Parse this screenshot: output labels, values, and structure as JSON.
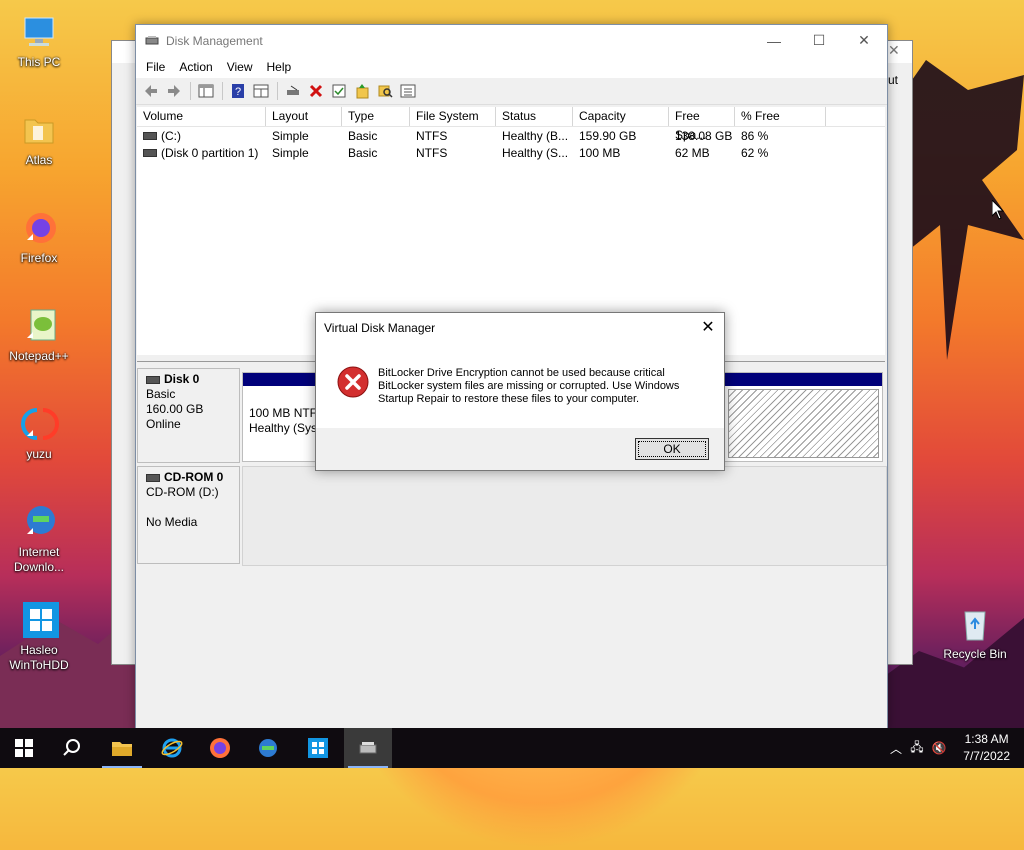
{
  "desktop": {
    "icons": [
      {
        "label": "This PC",
        "icon": "computer-icon"
      },
      {
        "label": "Atlas",
        "icon": "folder-icon"
      },
      {
        "label": "Firefox",
        "icon": "firefox-icon"
      },
      {
        "label": "Notepad++",
        "icon": "notepadpp-icon"
      },
      {
        "label": "yuzu",
        "icon": "yuzu-icon"
      },
      {
        "label": "Internet Downlo...",
        "icon": "idm-icon"
      },
      {
        "label": "Hasleo WinToHDD",
        "icon": "hasleo-icon"
      },
      {
        "label": "Recycle Bin",
        "icon": "recycle-bin-icon"
      }
    ],
    "bg_window_text": "ut"
  },
  "window": {
    "title": "Disk Management",
    "menu": [
      "File",
      "Action",
      "View",
      "Help"
    ],
    "columns": [
      "Volume",
      "Layout",
      "Type",
      "File System",
      "Status",
      "Capacity",
      "Free Spa...",
      "% Free"
    ],
    "rows": [
      [
        "(C:)",
        "Simple",
        "Basic",
        "NTFS",
        "Healthy (B...",
        "159.90 GB",
        "138.08 GB",
        "86 %"
      ],
      [
        "(Disk 0 partition 1)",
        "Simple",
        "Basic",
        "NTFS",
        "Healthy (S...",
        "100 MB",
        "62 MB",
        "62 %"
      ]
    ],
    "disks": [
      {
        "name": "Disk 0",
        "type": "Basic",
        "size": "160.00 GB",
        "state": "Online",
        "partition_size": "100 MB NTFS",
        "partition_status": "Healthy (Syst"
      },
      {
        "name": "CD-ROM 0",
        "type": "CD-ROM (D:)",
        "state": "No Media"
      }
    ]
  },
  "dialog": {
    "title": "Virtual Disk Manager",
    "message": "BitLocker Drive Encryption cannot be used because critical BitLocker system files are missing or corrupted. Use Windows Startup Repair to restore these files to your computer.",
    "ok_label": "OK"
  },
  "taskbar": {
    "time": "1:38 AM",
    "date": "7/7/2022"
  },
  "colors": {
    "partition_bar": "#00007a",
    "error_red": "#d32f2f"
  }
}
